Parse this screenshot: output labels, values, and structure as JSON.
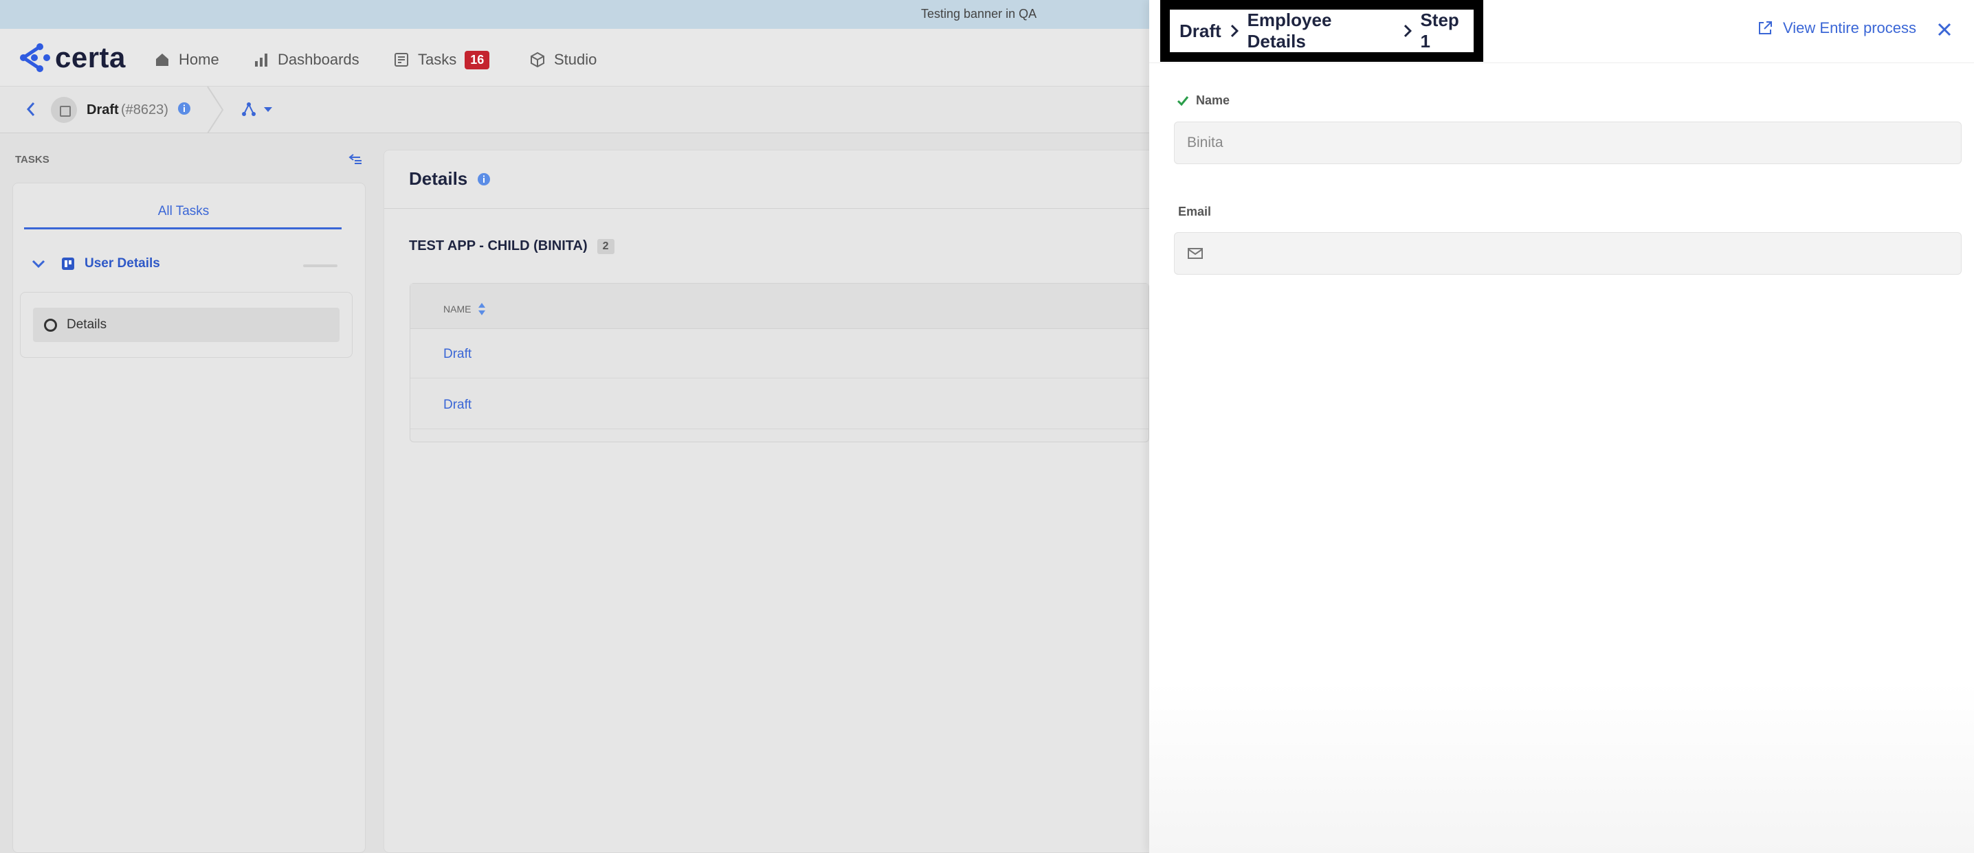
{
  "banner": {
    "text": "Testing banner in QA"
  },
  "app": {
    "logo_text": "certa",
    "nav": [
      {
        "label": "Home",
        "icon": "home-icon"
      },
      {
        "label": "Dashboards",
        "icon": "bar-chart-icon"
      },
      {
        "label": "Tasks",
        "icon": "tasks-icon",
        "badge": "16"
      },
      {
        "label": "Studio",
        "icon": "cube-icon"
      }
    ],
    "colors": {
      "accent": "#3a66d6",
      "badge": "#c4232e",
      "navy": "#1e2440"
    }
  },
  "subbar": {
    "title": "Draft",
    "id": "(#8623)"
  },
  "sidebar": {
    "section_label": "TASKS",
    "tab": "All Tasks",
    "group": "User Details",
    "item": "Details"
  },
  "main": {
    "title": "Details",
    "table_title": "TEST APP - CHILD (BINITA)",
    "table_count": "2",
    "column": "NAME",
    "rows": [
      "Draft",
      "Draft"
    ]
  },
  "drawer": {
    "breadcrumb": [
      "Draft",
      "Employee Details",
      "Step 1"
    ],
    "view_process": "View Entire process",
    "fields": {
      "name_label": "Name",
      "name_value": "Binita",
      "email_label": "Email",
      "email_value": ""
    }
  }
}
